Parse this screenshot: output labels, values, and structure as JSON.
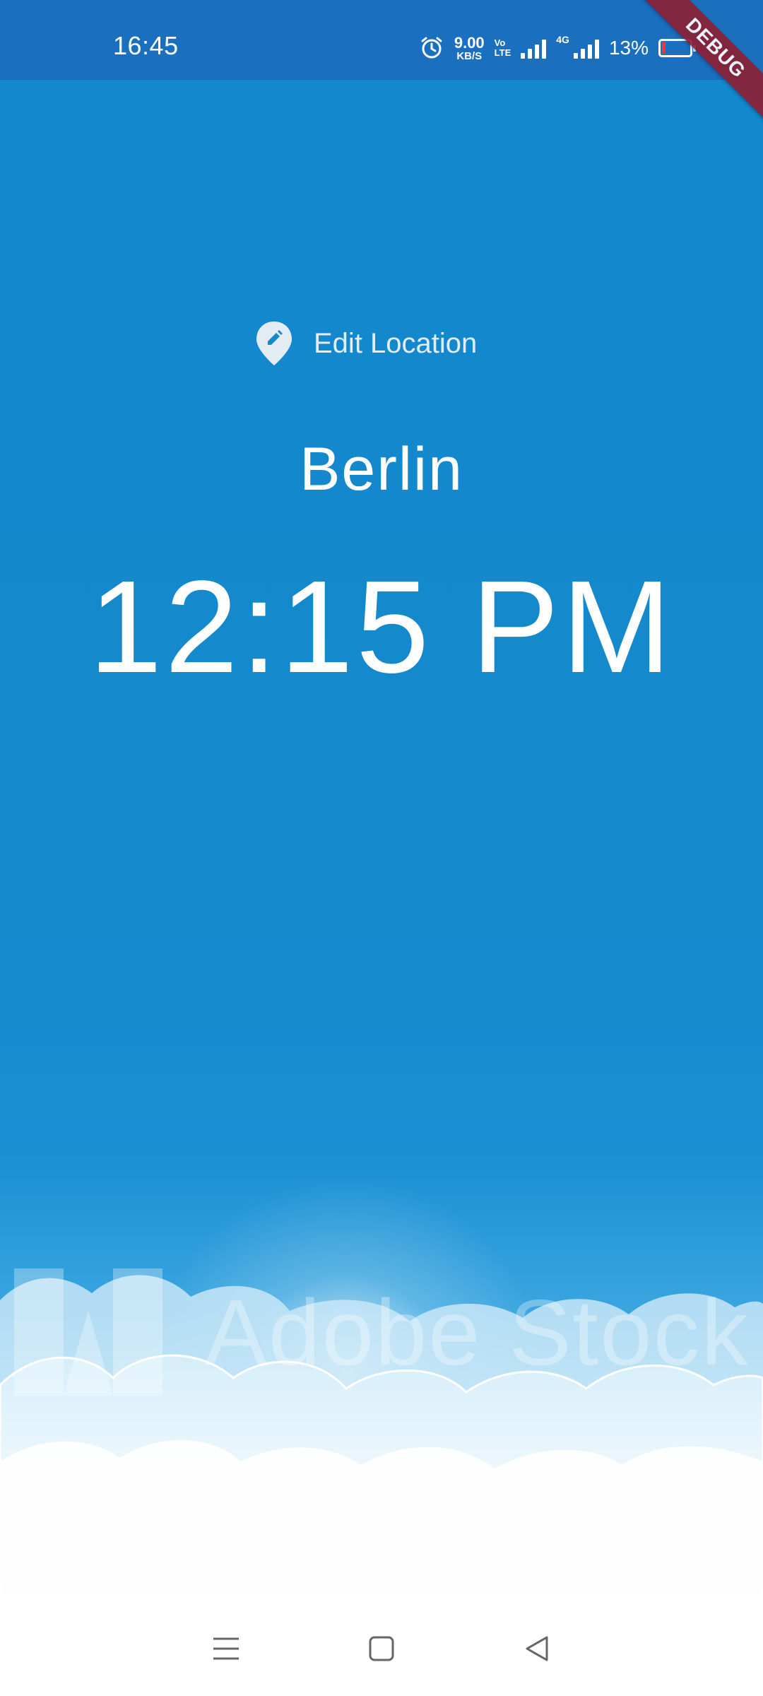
{
  "status_bar": {
    "time": "16:45",
    "net_speed_value": "9.00",
    "net_speed_unit": "KB/S",
    "volte_line1": "Vo",
    "volte_line2": "LTE",
    "network_type": "4G",
    "battery_percent": "13%",
    "battery_level": 0.13,
    "battery_color": "#ff3333",
    "icons": [
      "alarm-icon",
      "signal-icon",
      "signal-icon",
      "battery-icon"
    ]
  },
  "debug_banner": {
    "label": "DEBUG",
    "color": "#8b2035"
  },
  "location": {
    "edit_label": "Edit Location",
    "icon": "edit-location-icon",
    "city": "Berlin",
    "time": "12:15 PM"
  },
  "background": {
    "sky_color": "#1388cc",
    "watermark_text": "Adobe Stock"
  },
  "nav_bar": {
    "buttons": [
      "menu-icon",
      "home-icon",
      "back-icon"
    ]
  }
}
